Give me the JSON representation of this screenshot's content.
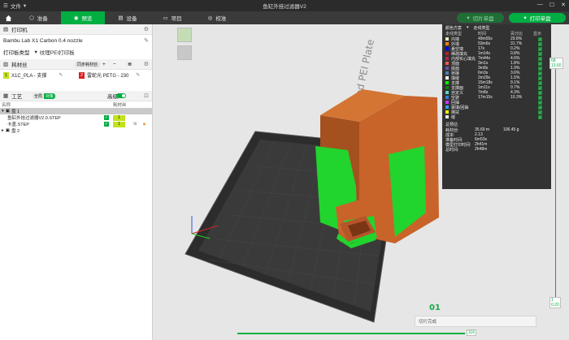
{
  "titlebar": {
    "file_menu": "文件",
    "title": "鱼缸外挂过滤器V2",
    "win_min": "—",
    "win_max": "☐",
    "win_close": "✕"
  },
  "toolbar": {
    "tabs": [
      {
        "label": "准备",
        "icon": "cube-icon"
      },
      {
        "label": "预览",
        "icon": "eye-icon"
      },
      {
        "label": "设备",
        "icon": "printer-icon"
      },
      {
        "label": "项目",
        "icon": "folder-icon"
      },
      {
        "label": "校准",
        "icon": "calibrate-icon"
      }
    ],
    "slice_plate": "切片单盘",
    "print_plate": "打印单盘"
  },
  "printer": {
    "section_title": "打印机",
    "name": "Bambu Lab X1 Carbon 0.4 nozzle",
    "plate_type_label": "打印板类型",
    "plate_type_value": "纹理PEI打印板"
  },
  "filament": {
    "section_title": "耗材丝",
    "sync_btn": "同步耗材丝",
    "add": "+",
    "remove": "−",
    "items": [
      {
        "index": "1",
        "name": "X1C_PLA - 支撑",
        "color": "#c2e21a"
      },
      {
        "index": "2",
        "name": "雷蛇光 PETG - 230",
        "color": "#d81f1f"
      }
    ]
  },
  "process": {
    "section_title": "工艺",
    "global_label": "全局",
    "object_label": "对象",
    "advanced_label": "高级",
    "col_name": "名称",
    "col_filament": "耗材丝",
    "tree": [
      {
        "label": "盘 1",
        "level": 0,
        "expanded": true,
        "selected": true
      },
      {
        "label": "鱼缸外挂过滤器V2.0.STEP",
        "level": 1,
        "filament": "1"
      },
      {
        "label": "卡盖.STEP",
        "level": 1,
        "filament": "1"
      },
      {
        "label": "盘 2",
        "level": 0,
        "expanded": false
      }
    ]
  },
  "legend": {
    "scheme_label": "颜色方案",
    "scheme_value": "走线类型",
    "col_type": "走线类型",
    "col_time": "时间",
    "col_pct": "百分比",
    "col_show": "显示",
    "rows": [
      {
        "name": "内墙",
        "time": "49m55s",
        "pct": "29.8%",
        "color": "#ffe6b3"
      },
      {
        "name": "外墙",
        "time": "53m6s",
        "pct": "31.7%",
        "color": "#ff8000"
      },
      {
        "name": "悬空墙",
        "time": "17s",
        "pct": "0.2%",
        "color": "#0000ff"
      },
      {
        "name": "稀疏填充",
        "time": "1m14s",
        "pct": "0.8%",
        "color": "#b32525"
      },
      {
        "name": "内部实心填充",
        "time": "7m44s",
        "pct": "4.6%",
        "color": "#b2274f"
      },
      {
        "name": "顶面",
        "time": "3m1s",
        "pct": "1.8%",
        "color": "#f05a4c"
      },
      {
        "name": "底面",
        "time": "3m8s",
        "pct": "1.9%",
        "color": "#6a4ea8"
      },
      {
        "name": "桥接",
        "time": "6m3s",
        "pct": "3.6%",
        "color": "#4d80ba"
      },
      {
        "name": "填缝",
        "time": "2m29s",
        "pct": "1.5%",
        "color": "#ffffff"
      },
      {
        "name": "支撑",
        "time": "15m18s",
        "pct": "9.1%",
        "color": "#00ff00"
      },
      {
        "name": "支撑面",
        "time": "1m11s",
        "pct": "0.7%",
        "color": "#008000"
      },
      {
        "name": "自定义",
        "time": "7m8s",
        "pct": "4.3%",
        "color": "#5ed1cc"
      },
      {
        "name": "空驶",
        "time": "17m15s",
        "pct": "10.3%",
        "color": "#3a7bd5"
      },
      {
        "name": "回抽",
        "time": "",
        "pct": "",
        "color": "#cc33ff"
      },
      {
        "name": "装填/回抽",
        "time": "",
        "pct": "",
        "color": "#33a0e0"
      },
      {
        "name": "擦拭",
        "time": "",
        "pct": "",
        "color": "#ffff00"
      },
      {
        "name": "缝",
        "time": "",
        "pct": "",
        "color": "#e6e6e6"
      }
    ],
    "stats_title": "总预估",
    "stats": [
      {
        "label": "耗材丝:",
        "v1": "35.69 m",
        "v2": "106.45 g"
      },
      {
        "label": "成本:",
        "v1": "2.13",
        "v2": ""
      },
      {
        "label": "准备时间:",
        "v1": "6m53s",
        "v2": ""
      },
      {
        "label": "模型打印时间:",
        "v1": "2h41m",
        "v2": ""
      },
      {
        "label": "总时间:",
        "v1": "2h48m",
        "v2": ""
      }
    ]
  },
  "plate": {
    "label": "Bambu Textured PEI Plate",
    "number": "01"
  },
  "sliders": {
    "layer_top": "68",
    "layer_top_height": "13.60",
    "layer_bottom": "1",
    "layer_bottom_height": "0.20",
    "move_value": "116"
  },
  "toast": {
    "text": "切片完成"
  },
  "colors": {
    "accent": "#00ae42",
    "model_orange": "#c8642a",
    "support_green": "#22d42e"
  }
}
